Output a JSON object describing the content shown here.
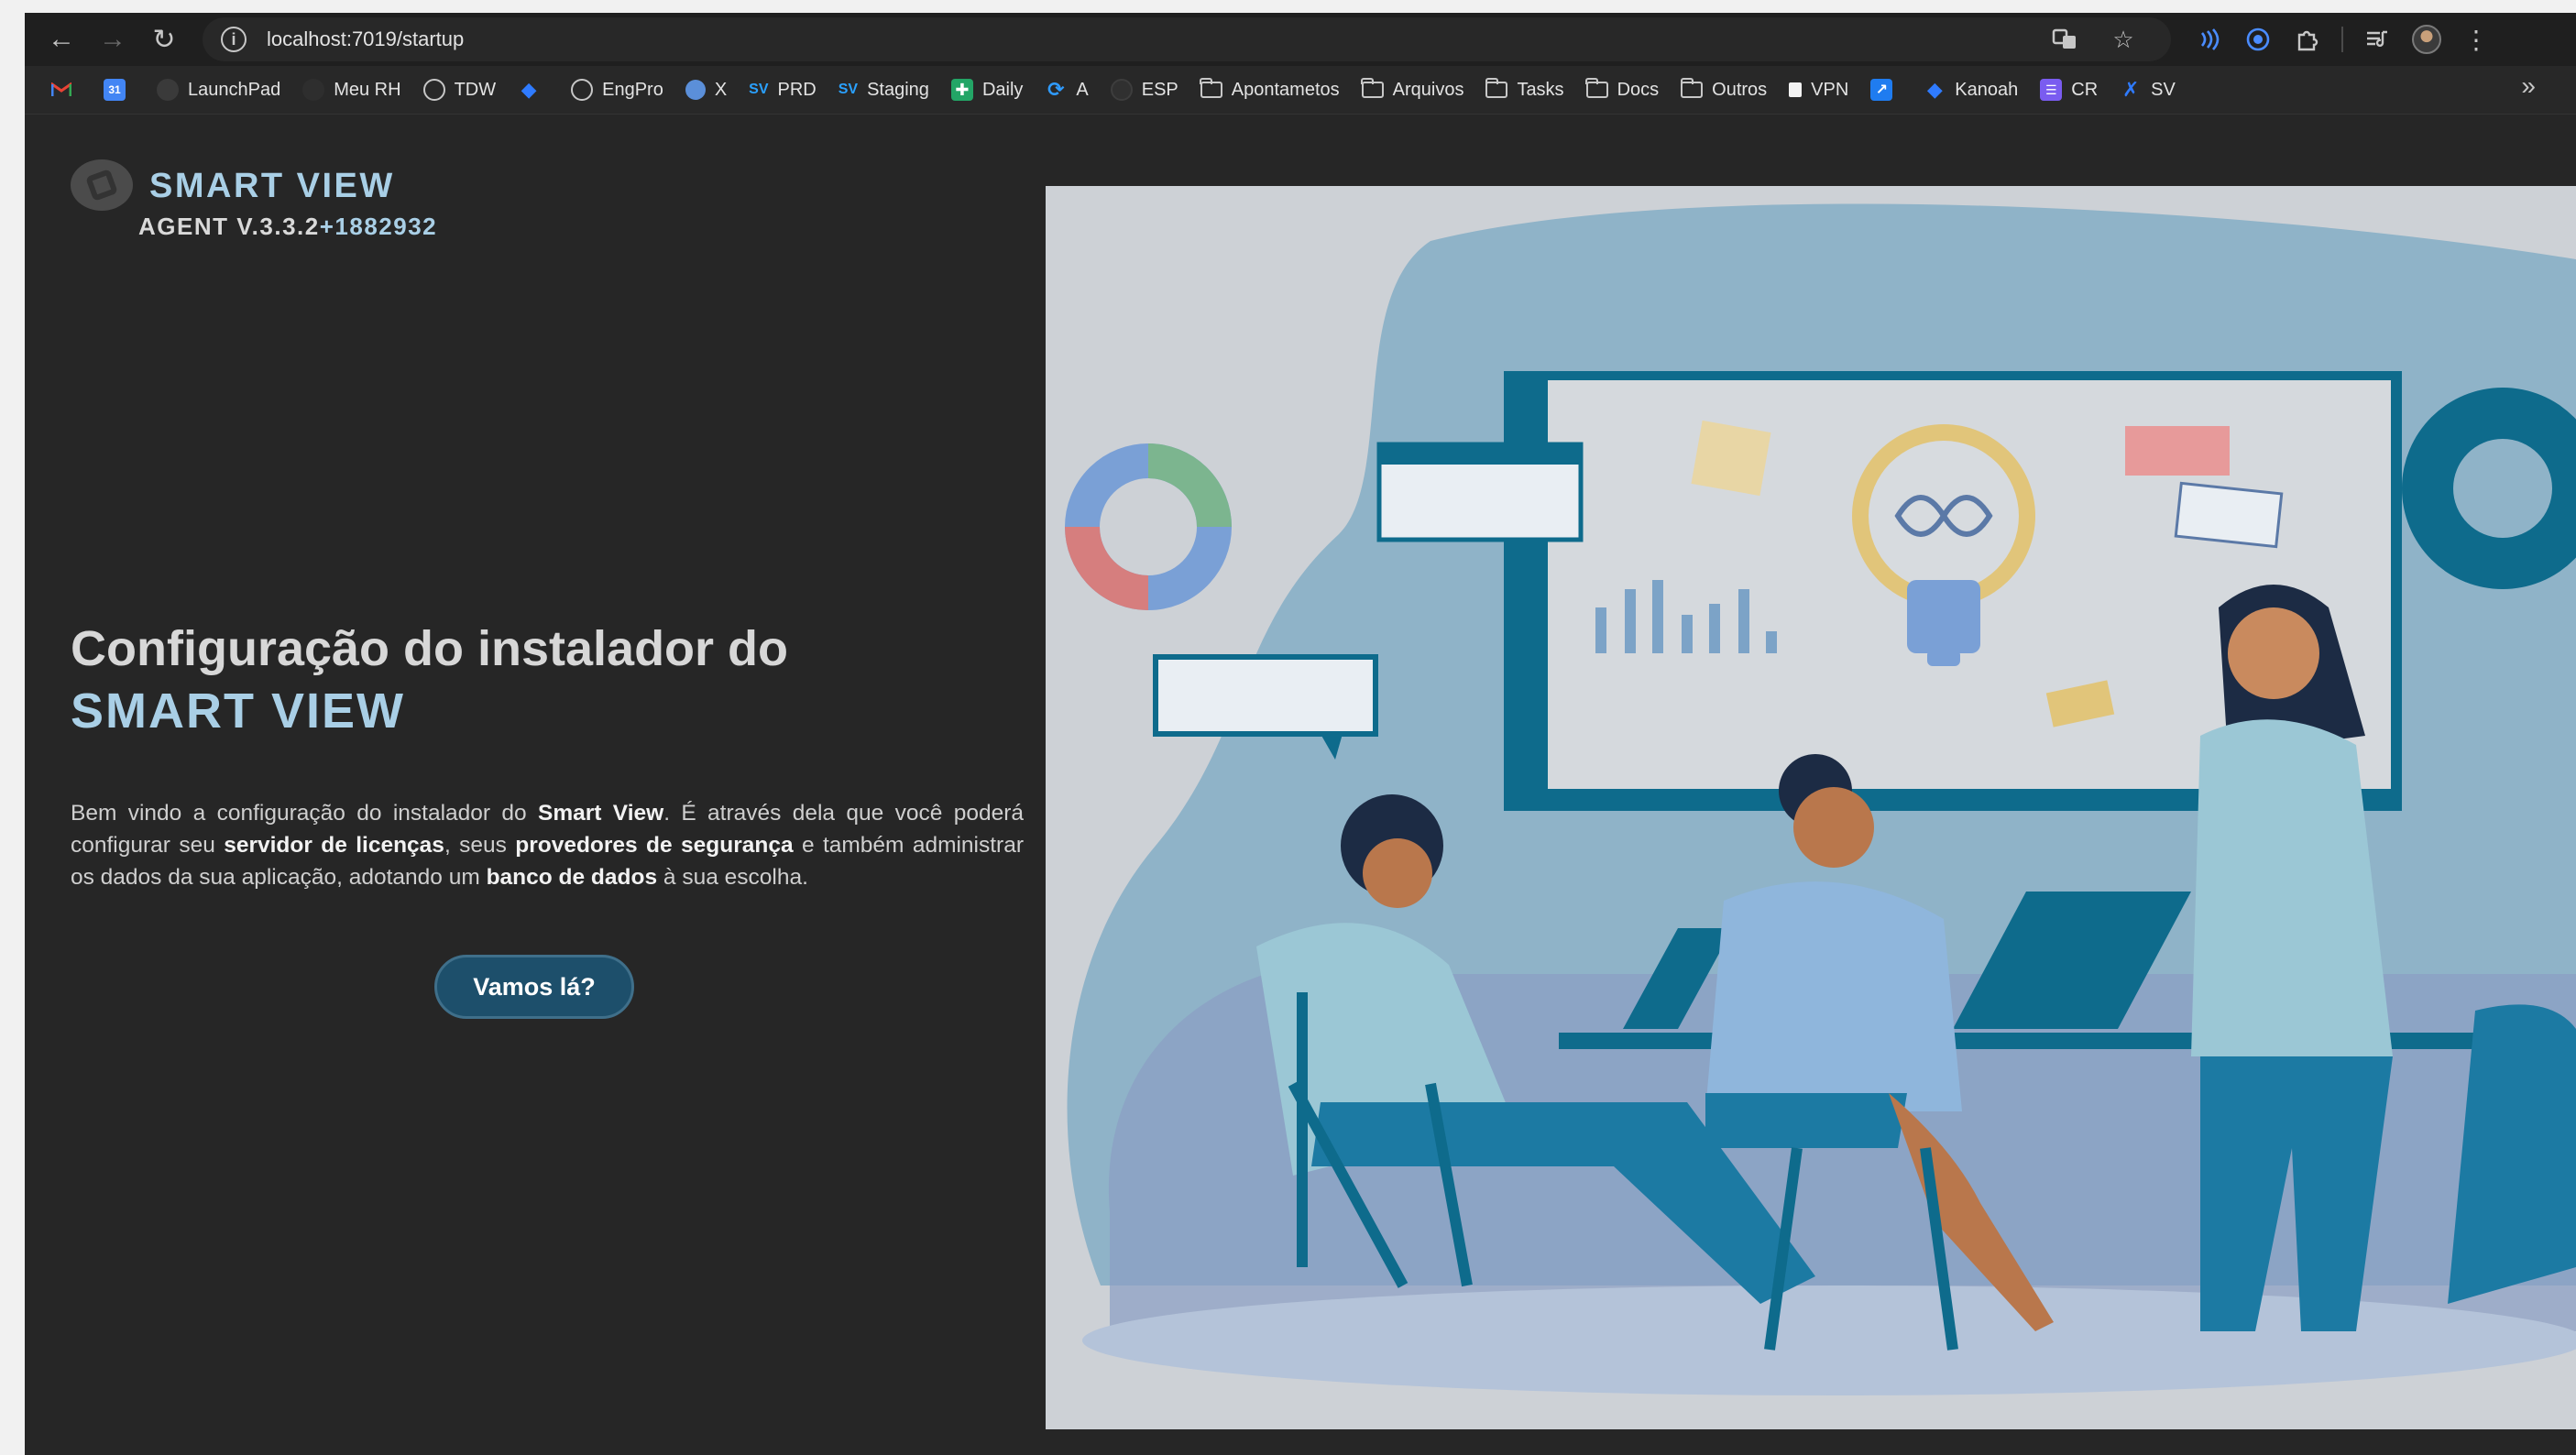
{
  "browser": {
    "url": "localhost:7019/startup",
    "bookmarks": [
      {
        "label": "",
        "icon": "gmail-icon"
      },
      {
        "label": "",
        "icon": "calendar-icon"
      },
      {
        "label": "LaunchPad",
        "icon": "launchpad-icon"
      },
      {
        "label": "Meu RH",
        "icon": "meurh-icon"
      },
      {
        "label": "TDW",
        "icon": "globe-icon"
      },
      {
        "label": "",
        "icon": "diamond-icon"
      },
      {
        "label": "EngPro",
        "icon": "globe-icon"
      },
      {
        "label": "X",
        "icon": "globe-icon"
      },
      {
        "label": "PRD",
        "icon_text": "SV"
      },
      {
        "label": "Staging",
        "icon_text": "SV"
      },
      {
        "label": "Daily",
        "icon": "sheet-icon"
      },
      {
        "label": "A",
        "icon": "azure-icon"
      },
      {
        "label": "ESP",
        "icon": "esp-icon"
      },
      {
        "label": "Apontametos",
        "icon": "folder-icon"
      },
      {
        "label": "Arquivos",
        "icon": "folder-icon"
      },
      {
        "label": "Tasks",
        "icon": "folder-icon"
      },
      {
        "label": "Docs",
        "icon": "folder-icon"
      },
      {
        "label": "Outros",
        "icon": "folder-icon"
      },
      {
        "label": "VPN",
        "icon": "vpn-icon"
      },
      {
        "label": "",
        "icon": "jira-icon"
      },
      {
        "label": "Kanoah",
        "icon": "diamond-icon"
      },
      {
        "label": "CR",
        "icon": "list-icon"
      },
      {
        "label": "SV",
        "icon": "confluence-icon"
      }
    ],
    "colors": {
      "toolbar": "#1f1f1f",
      "bookmarks_bar": "#282828"
    }
  },
  "app": {
    "brand_name": "SMART VIEW",
    "version_prefix": "AGENT V.3.3.2",
    "version_build": "+1882932",
    "heading_line1": "Configuração do instalador do",
    "heading_line2": "SMART VIEW",
    "intro": {
      "t1": "Bem vindo a configuração do instalador do ",
      "b1": "Smart View",
      "t2": ". É através dela que você poderá configurar seu ",
      "b2": "servidor de licenças",
      "t3": ", seus ",
      "b3": "provedores de segurança",
      "t4": " e também administrar os dados da sua aplicação, adotando um ",
      "b4": "banco de dados",
      "t5": " à sua escolha."
    },
    "cta_label": "Vamos lá?",
    "colors": {
      "background": "#262626",
      "accent": "#a9cfe6",
      "button": "#1d4f6b"
    }
  }
}
